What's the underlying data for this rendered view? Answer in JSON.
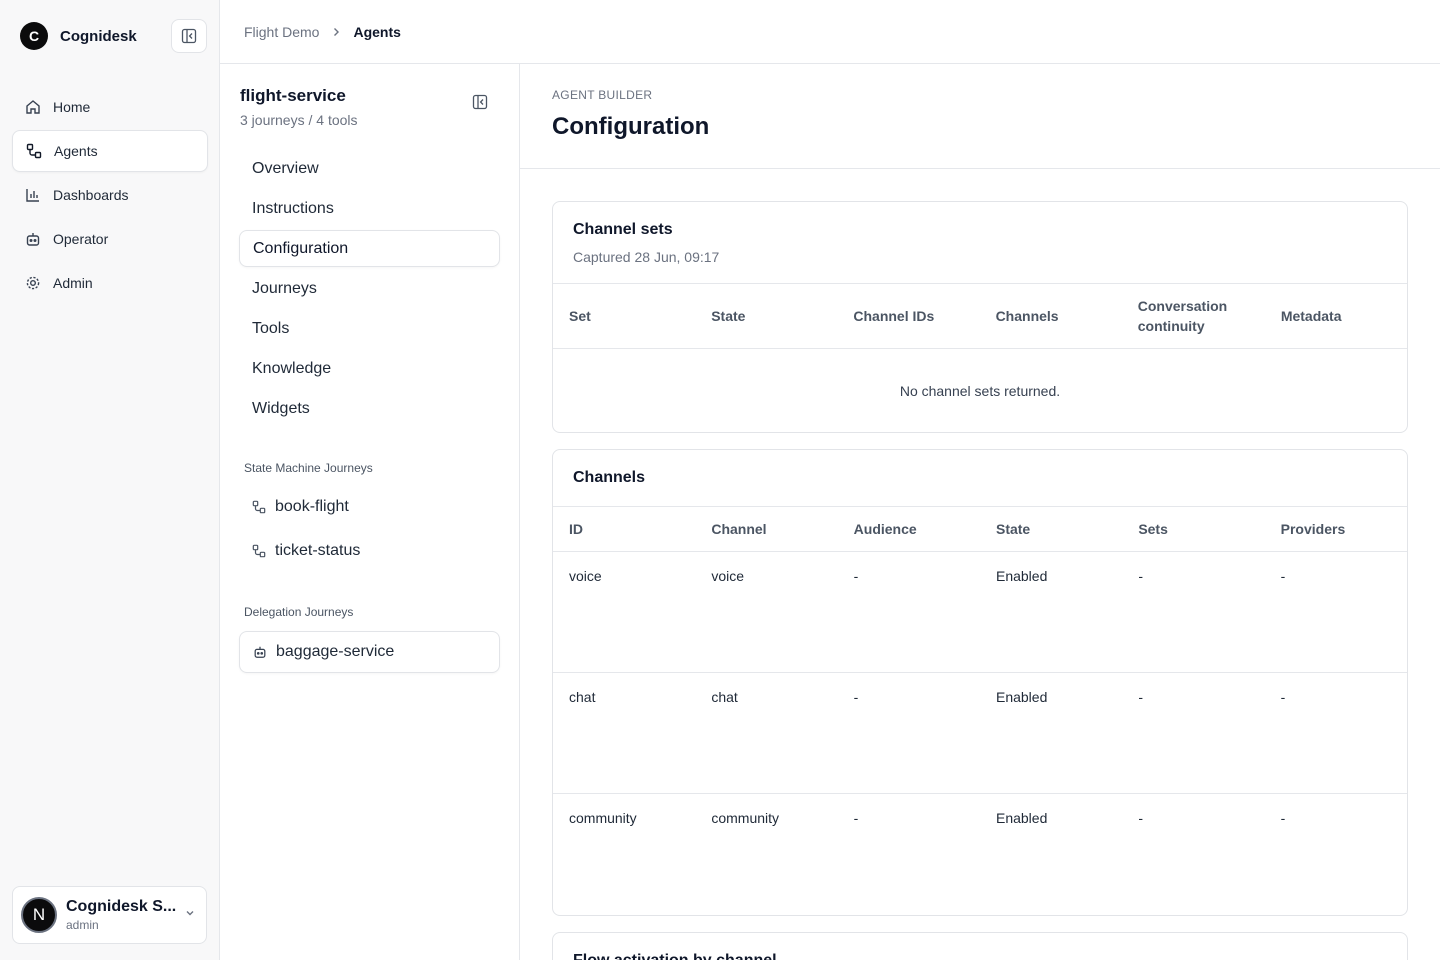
{
  "app": {
    "brand_initial": "C",
    "brand_name": "Cognidesk",
    "nav": [
      {
        "label": "Home",
        "icon": "home-icon"
      },
      {
        "label": "Agents",
        "icon": "agents-icon",
        "active": true
      },
      {
        "label": "Dashboards",
        "icon": "chart-icon"
      },
      {
        "label": "Operator",
        "icon": "bot-icon"
      },
      {
        "label": "Admin",
        "icon": "gear-icon"
      }
    ],
    "user": {
      "initial": "N",
      "name": "Cognidesk S...",
      "role": "admin"
    }
  },
  "breadcrumb": {
    "parent": "Flight Demo",
    "current": "Agents"
  },
  "agent": {
    "name": "flight-service",
    "meta": "3 journeys / 4 tools",
    "sections": [
      "Overview",
      "Instructions",
      "Configuration",
      "Journeys",
      "Tools",
      "Knowledge",
      "Widgets"
    ],
    "active_section": "Configuration",
    "state_machine_label": "State Machine Journeys",
    "state_machine_journeys": [
      "book-flight",
      "ticket-status"
    ],
    "delegation_label": "Delegation Journeys",
    "delegation_journeys": [
      "baggage-service"
    ]
  },
  "main": {
    "eyebrow": "AGENT BUILDER",
    "title": "Configuration",
    "channel_sets": {
      "title": "Channel sets",
      "captured": "Captured 28 Jun, 09:17",
      "columns": [
        "Set",
        "State",
        "Channel IDs",
        "Channels",
        "Conversation continuity",
        "Metadata"
      ],
      "empty_message": "No channel sets returned."
    },
    "channels": {
      "title": "Channels",
      "columns": [
        "ID",
        "Channel",
        "Audience",
        "State",
        "Sets",
        "Providers"
      ],
      "rows": [
        [
          "voice",
          "voice",
          "-",
          "Enabled",
          "-",
          "-"
        ],
        [
          "chat",
          "chat",
          "-",
          "Enabled",
          "-",
          "-"
        ],
        [
          "community",
          "community",
          "-",
          "Enabled",
          "-",
          "-"
        ]
      ]
    },
    "next_section_title": "Flow activation by channel"
  }
}
